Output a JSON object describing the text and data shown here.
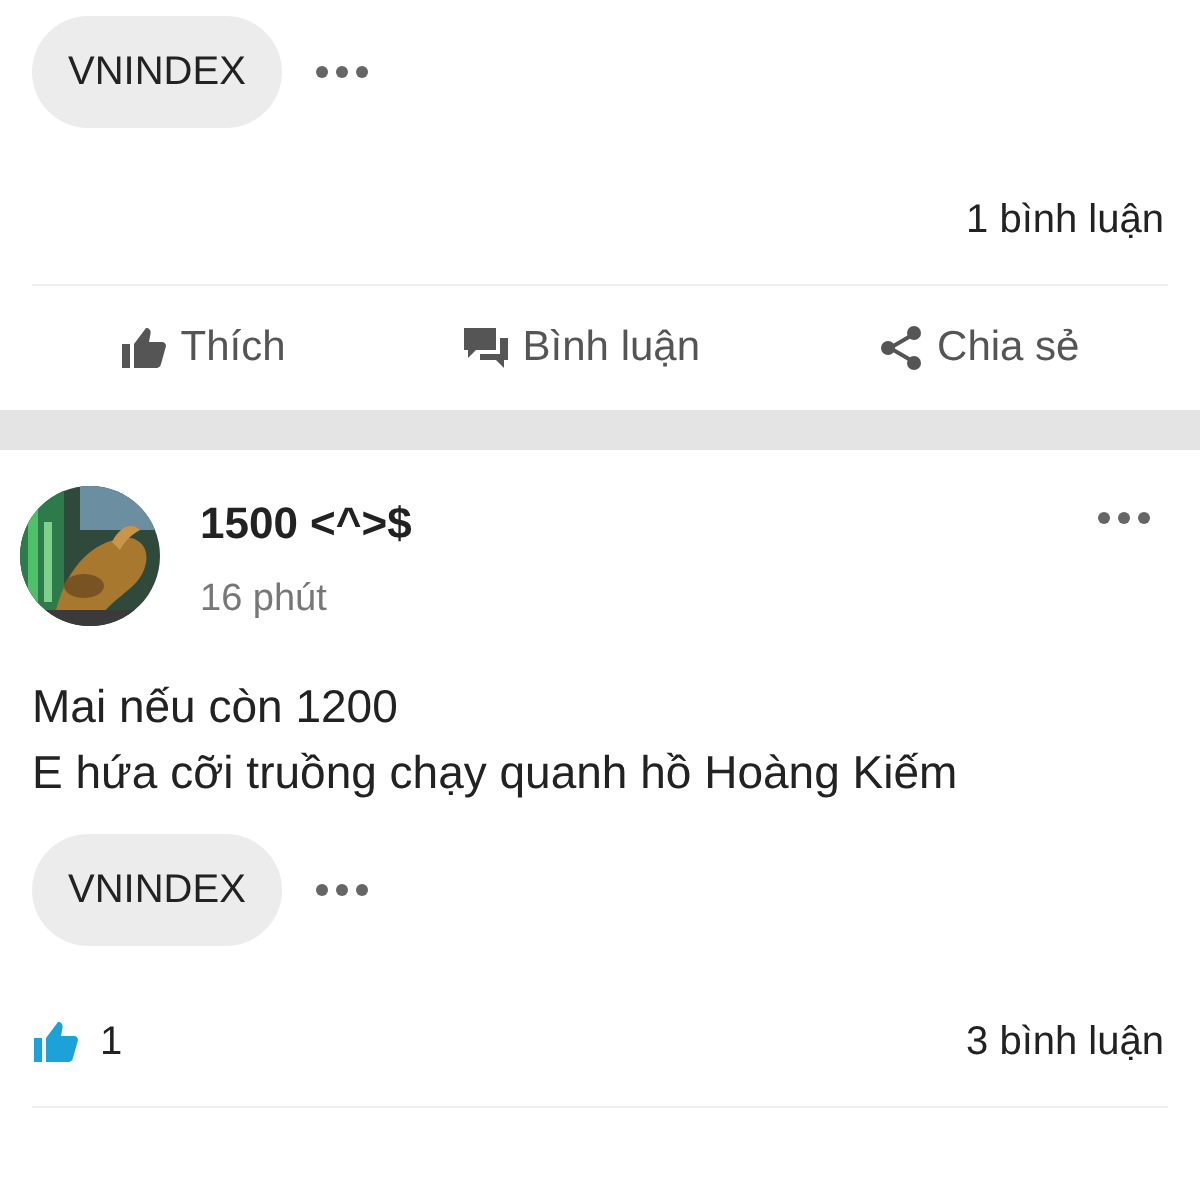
{
  "posts": [
    {
      "tags": [
        "VNINDEX"
      ],
      "comment_count": "1 bình luận",
      "actions": [
        {
          "kind": "like",
          "label": "Thích"
        },
        {
          "kind": "comment",
          "label": "Bình luận"
        },
        {
          "kind": "share",
          "label": "Chia sẻ"
        }
      ]
    },
    {
      "author": {
        "name": "1500 <^>$",
        "time": "16 phút"
      },
      "body": [
        "Mai nếu còn 1200",
        "E hứa cỡi truồng chạy quanh hồ Hoàng Kiếm"
      ],
      "tags": [
        "VNINDEX"
      ],
      "like_count": "1",
      "comment_count": "3 bình luận"
    }
  ]
}
